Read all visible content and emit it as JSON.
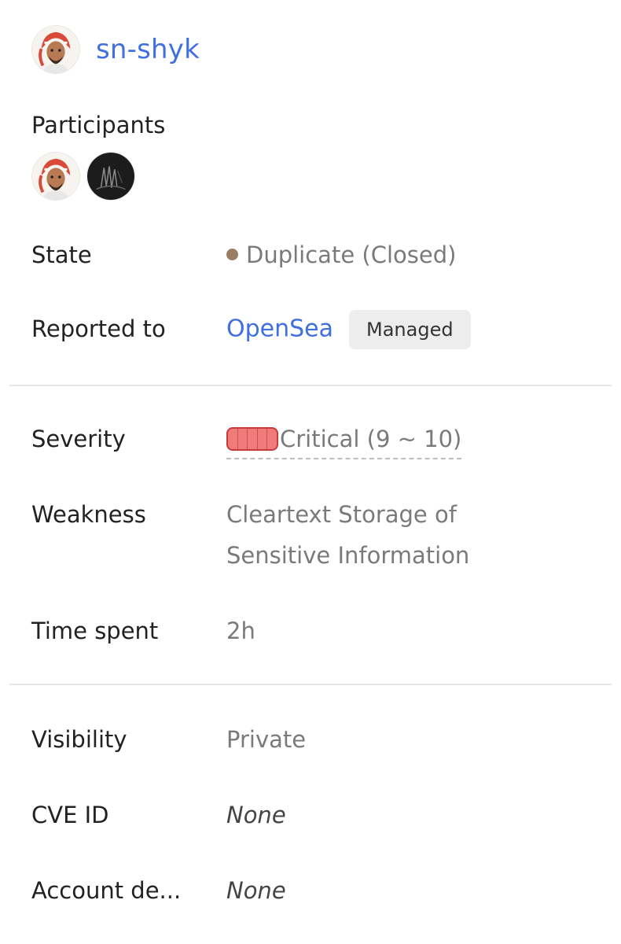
{
  "reporter": {
    "username": "sn-shyk",
    "avatar_icon": "reporter-avatar-icon"
  },
  "participants": {
    "label": "Participants",
    "avatars": [
      "reporter-avatar-icon",
      "participant-dark-avatar-icon"
    ]
  },
  "fields": {
    "state": {
      "label": "State",
      "value": "Duplicate (Closed)",
      "dot_color": "#9a7e62"
    },
    "reported_to": {
      "label": "Reported to",
      "program": "OpenSea",
      "badge": "Managed"
    },
    "severity": {
      "label": "Severity",
      "value": "Critical (9 ~ 10)",
      "color": "#f07b7b"
    },
    "weakness": {
      "label": "Weakness",
      "value_line1": "Cleartext Storage of",
      "value_line2": "Sensitive Information"
    },
    "time_spent": {
      "label": "Time spent",
      "value": "2h"
    },
    "visibility": {
      "label": "Visibility",
      "value": "Private"
    },
    "cve_id": {
      "label": "CVE ID",
      "value": "None"
    },
    "account_details": {
      "label": "Account de...",
      "value": "None"
    }
  },
  "colors": {
    "link": "#3f6fe0",
    "muted_text": "#7a7a7a",
    "divider": "#e6e6e6",
    "badge_bg": "#ededed"
  }
}
